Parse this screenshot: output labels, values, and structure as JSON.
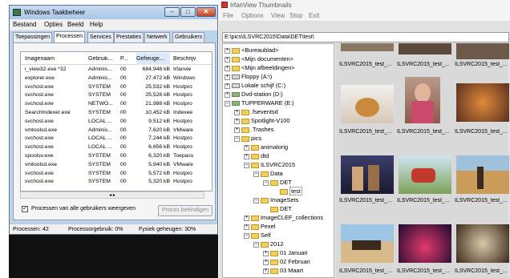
{
  "taskmgr": {
    "title": "Windows Taakbeheer",
    "menu": [
      "Bestand",
      "Opties",
      "Beeld",
      "Help"
    ],
    "tabs": [
      "Toepassingen",
      "Processen",
      "Services",
      "Prestaties",
      "Netwerk",
      "Gebruikers"
    ],
    "columns": [
      "Imagenaam",
      "Gebruik...",
      "P...",
      "Geheuge...",
      "Beschrijv"
    ],
    "rows": [
      [
        "i_view32.exe *32",
        "Adminis...",
        "00",
        "684,948 kB",
        "Irfanvie"
      ],
      [
        "explorer.exe",
        "Adminis...",
        "00",
        "27,472 kB",
        "Windows"
      ],
      [
        "svchost.exe",
        "SYSTEM",
        "00",
        "25,532 kB",
        "Hostpro"
      ],
      [
        "svchost.exe",
        "SYSTEM",
        "00",
        "25,528 kB",
        "Hostpro"
      ],
      [
        "svchost.exe",
        "NETWO...",
        "00",
        "21,988 kB",
        "Hostpro"
      ],
      [
        "SearchIndexer.exe",
        "SYSTEM",
        "00",
        "10,452 kB",
        "Indexee"
      ],
      [
        "svchost.exe",
        "LOCAL ...",
        "00",
        "9,512 kB",
        "Hostpro"
      ],
      [
        "vmtoolsd.exe",
        "Adminis...",
        "00",
        "7,620 kB",
        "VMware"
      ],
      [
        "svchost.exe",
        "LOCAL ...",
        "00",
        "7,244 kB",
        "Hostpro"
      ],
      [
        "svchost.exe",
        "LOCAL ...",
        "00",
        "6,656 kB",
        "Hostpro"
      ],
      [
        "spoolsv.exe",
        "SYSTEM",
        "00",
        "6,320 kB",
        "Toepass"
      ],
      [
        "vmtoolsd.exe",
        "SYSTEM",
        "00",
        "5,940 kB",
        "VMware"
      ],
      [
        "svchost.exe",
        "SYSTEM",
        "00",
        "5,572 kB",
        "Hostpro"
      ],
      [
        "svchost.exe",
        "SYSTEM",
        "00",
        "5,320 kB",
        "Hostpro"
      ]
    ],
    "show_all_label": "Processen van alle gebruikers weergeven",
    "end_process_label": "Proces beëindigen",
    "status": [
      "Processen: 42",
      "Processorgebruik: 0%",
      "Fysiek geheugen: 30%"
    ]
  },
  "irfan": {
    "title": "IrfanView Thumbnails",
    "menu": [
      "File",
      "Options",
      "View",
      "Stop",
      "Exit"
    ],
    "path": "E:\\pics\\ILSVRC2015\\Data\\DET\\test\\",
    "tree": [
      "<Bureaublad>",
      "<Mijn documenten>",
      "<Mijn afbeeldingen>",
      "Floppy (A:\\)",
      "Lokale schijf (C:)",
      "Dvd-station (D:)",
      "TUPPERWARE (E:)",
      ".fseventsd",
      "Spotlight-V100",
      ".Trashes",
      "pics",
      "animalorig",
      "dtd",
      "ILSVRC2015",
      "Data",
      "DET",
      "test",
      "ImageSets",
      "DET",
      "ImageCLEF_collections",
      "Pexel",
      "Self",
      "2012",
      "01 Januari",
      "02 Februari",
      "03 Maart"
    ],
    "caption": "ILSVRC2015_test_..."
  },
  "colors": {
    "win_title": "#bcd3ec",
    "selection": "#dbe9f8"
  }
}
